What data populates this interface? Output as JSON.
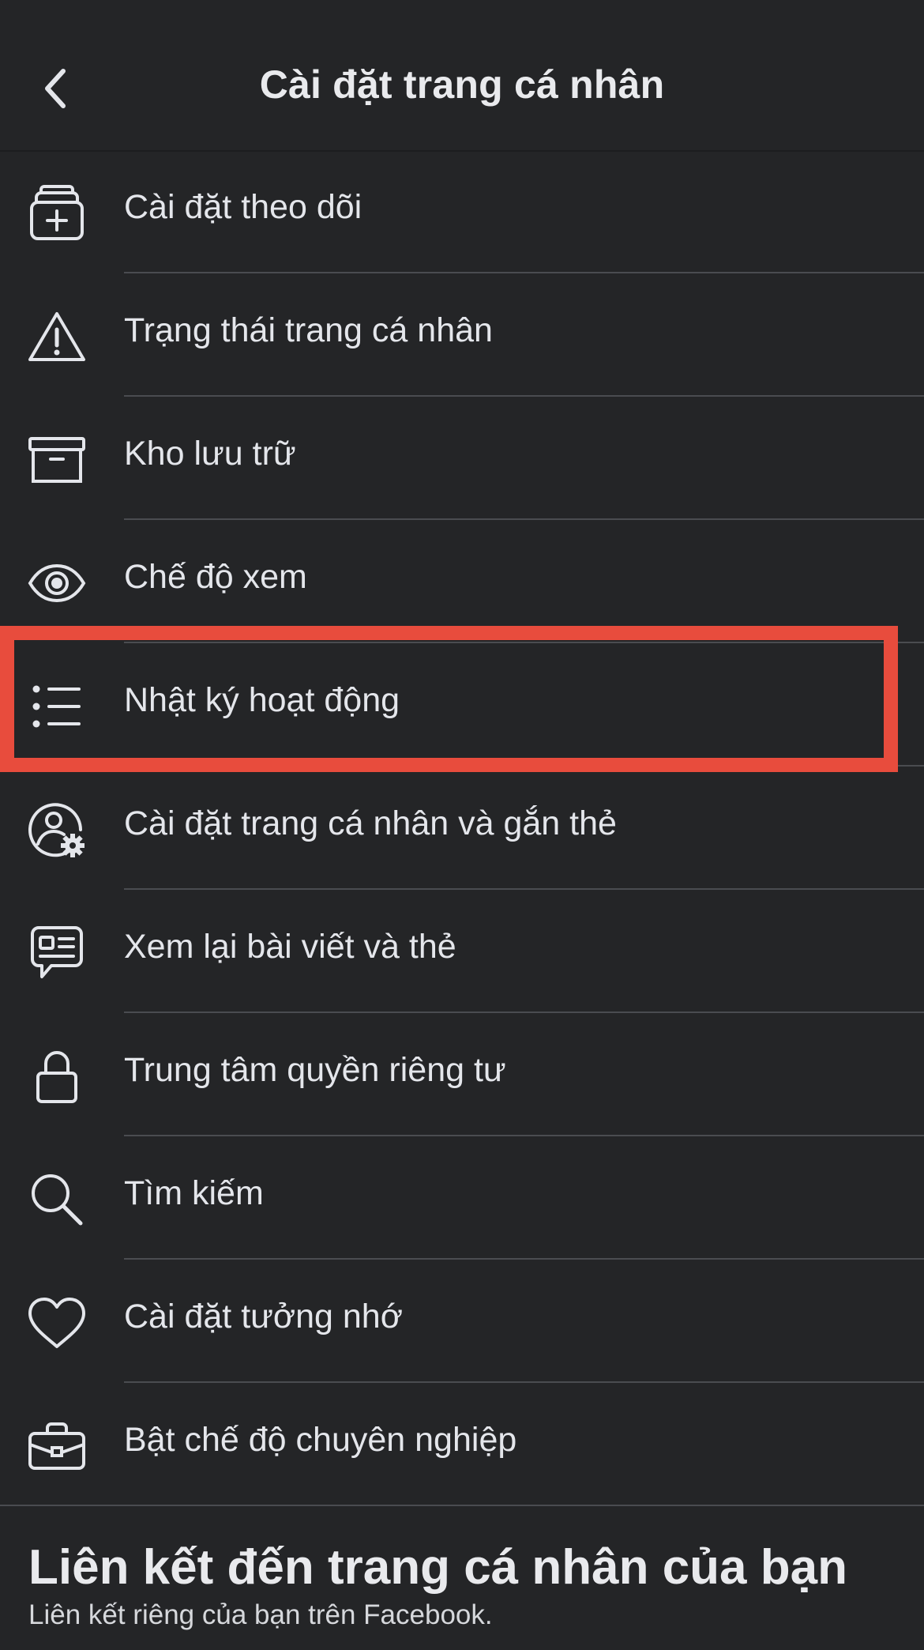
{
  "header": {
    "title": "Cài đặt trang cá nhân",
    "back_icon": "chevron-left-icon"
  },
  "menu": {
    "items": [
      {
        "label": "Cài đặt theo dõi",
        "icon": "follow-settings-icon"
      },
      {
        "label": "Trạng thái trang cá nhân",
        "icon": "warning-icon"
      },
      {
        "label": "Kho lưu trữ",
        "icon": "archive-icon"
      },
      {
        "label": "Chế độ xem",
        "icon": "eye-icon"
      },
      {
        "label": "Nhật ký hoạt động",
        "icon": "list-icon",
        "highlighted": true
      },
      {
        "label": "Cài đặt trang cá nhân và gắn thẻ",
        "icon": "user-gear-icon"
      },
      {
        "label": "Xem lại bài viết và thẻ",
        "icon": "post-review-icon"
      },
      {
        "label": "Trung tâm quyền riêng tư",
        "icon": "lock-icon"
      },
      {
        "label": "Tìm kiếm",
        "icon": "search-icon"
      },
      {
        "label": "Cài đặt tưởng nhớ",
        "icon": "heart-icon"
      },
      {
        "label": "Bật chế độ chuyên nghiệp",
        "icon": "briefcase-icon"
      }
    ]
  },
  "profile_link": {
    "title": "Liên kết đến trang cá nhân của bạn",
    "subtitle": "Liên kết riêng của bạn trên Facebook."
  },
  "colors": {
    "background": "#242527",
    "text": "#e4e6eb",
    "divider": "#4a4c50",
    "highlight_border": "#e84c3d"
  }
}
